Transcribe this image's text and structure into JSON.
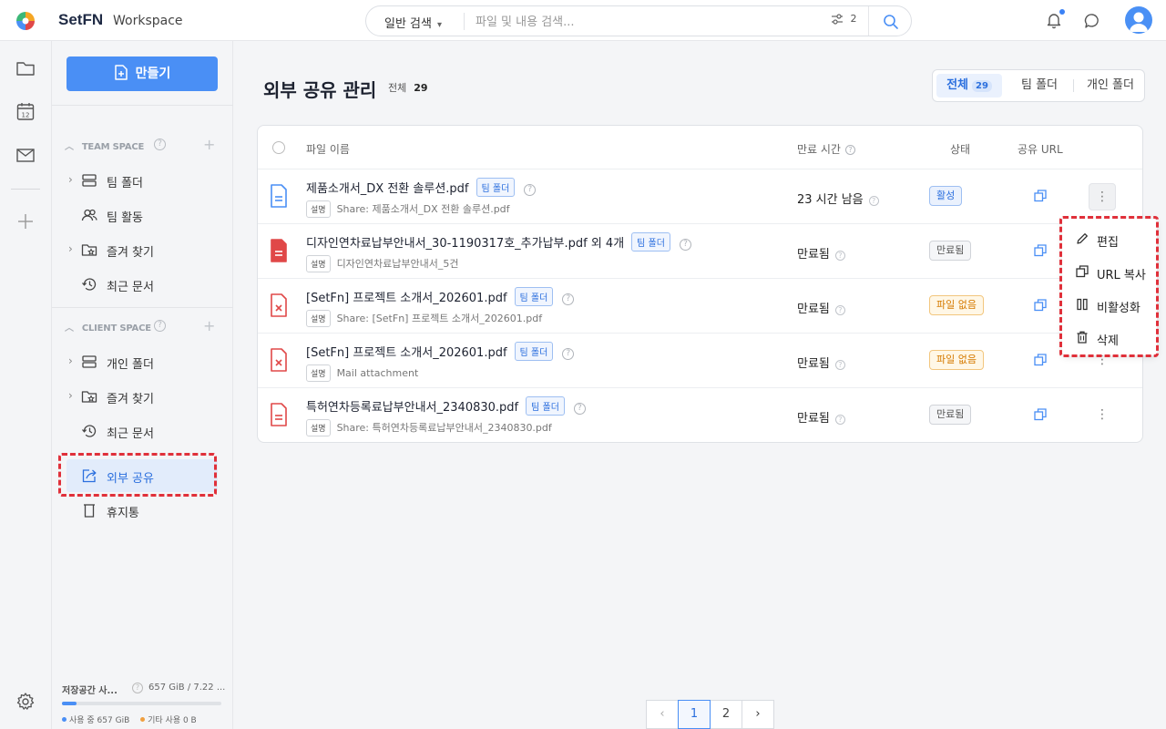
{
  "header": {
    "brand": "SetFN",
    "workspace": "Workspace",
    "search_mode": "일반 검색",
    "search_placeholder": "파일 및 내용 검색...",
    "filter_count": "2"
  },
  "sidebar": {
    "create_label": "만들기",
    "team_space_title": "TEAM SPACE",
    "team_items": [
      {
        "label": "팀 폴더",
        "icon": "folder-stack-icon"
      },
      {
        "label": "팀 활동",
        "icon": "people-icon"
      },
      {
        "label": "즐겨 찾기",
        "icon": "star-folder-icon"
      },
      {
        "label": "최근 문서",
        "icon": "history-icon"
      }
    ],
    "client_space_title": "CLIENT SPACE",
    "client_items": [
      {
        "label": "개인 폴더",
        "icon": "folder-stack-icon"
      },
      {
        "label": "즐겨 찾기",
        "icon": "star-folder-icon"
      },
      {
        "label": "최근 문서",
        "icon": "history-icon"
      }
    ],
    "share_item": "외부 공유",
    "trash_item": "휴지통",
    "storage": {
      "title": "저장공간 사...",
      "value": "657 GiB / 7.22 ...",
      "used_label": "사용 중 657 GiB",
      "other_label": "기타 사용 0 B",
      "used_fraction": 0.09,
      "used_color": "#4a8ff5",
      "other_color": "#f0a040"
    }
  },
  "main": {
    "title": "외부 공유 관리",
    "total_label": "전체",
    "total_count": "29",
    "tabs": [
      {
        "label": "전체",
        "count": "29"
      },
      {
        "label": "팀 폴더"
      },
      {
        "label": "개인 폴더"
      }
    ],
    "columns": {
      "name": "파일 이름",
      "expire": "만료 시간",
      "status": "상태",
      "url": "공유 URL"
    },
    "desc_badge": "설명",
    "rows": [
      {
        "name": "제품소개서_DX 전환 솔루션.pdf",
        "tag": "팀 폴더",
        "desc": "Share: 제품소개서_DX 전환 솔루션.pdf",
        "expire": "23 시간 남음",
        "status": "활성",
        "status_type": "active",
        "icon": "document-icon"
      },
      {
        "name": "디자인연차료납부안내서_30-1190317호_추가납부.pdf 외 4개",
        "tag": "팀 폴더",
        "desc": "디자인연차료납부안내서_5건",
        "expire": "만료됨",
        "status": "만료됨",
        "status_type": "expired",
        "icon": "document-filled-icon"
      },
      {
        "name": "[SetFn] 프로젝트 소개서_202601.pdf",
        "tag": "팀 폴더",
        "desc": "Share: [SetFn] 프로젝트 소개서_202601.pdf",
        "expire": "만료됨",
        "status": "파일 없음",
        "status_type": "missing",
        "icon": "missing-file-icon"
      },
      {
        "name": "[SetFn] 프로젝트 소개서_202601.pdf",
        "tag": "팀 폴더",
        "desc": "Mail attachment",
        "expire": "만료됨",
        "status": "파일 없음",
        "status_type": "missing",
        "icon": "missing-file-icon"
      },
      {
        "name": "특허연차등록료납부안내서_2340830.pdf",
        "tag": "팀 폴더",
        "desc": "Share: 특허연차등록료납부안내서_2340830.pdf",
        "expire": "만료됨",
        "status": "만료됨",
        "status_type": "expired",
        "icon": "document-red-icon"
      }
    ],
    "context_menu": [
      {
        "label": "편집",
        "icon": "pencil-icon"
      },
      {
        "label": "URL 복사",
        "icon": "copy-icon"
      },
      {
        "label": "비활성화",
        "icon": "pause-icon"
      },
      {
        "label": "삭제",
        "icon": "trash-icon"
      }
    ],
    "pagination": {
      "pages": [
        "1",
        "2"
      ],
      "current": "1"
    }
  },
  "colors": {
    "accent": "#4a8ff5",
    "highlight": "#e0303a",
    "file_blue": "#4a8ff5",
    "file_red": "#e04848"
  }
}
